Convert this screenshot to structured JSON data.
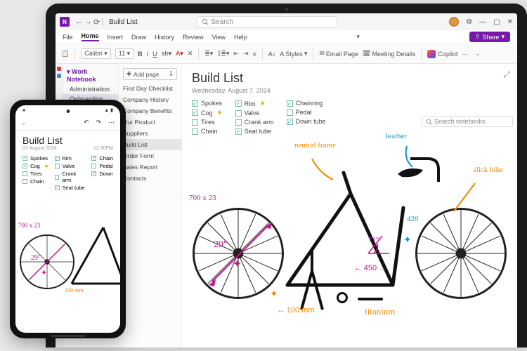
{
  "titlebar": {
    "app_glyph": "N",
    "doc_title": "Build List",
    "search_placeholder": "Search"
  },
  "window_controls": {
    "minimize": "—",
    "maximize": "▢",
    "close": "✕"
  },
  "menu": {
    "items": [
      "File",
      "Home",
      "Insert",
      "Draw",
      "History",
      "Review",
      "View",
      "Help"
    ],
    "active_index": 1,
    "share_label": "Share"
  },
  "ribbon": {
    "font_name": "Calibri",
    "font_size": "11",
    "styles_label": "Styles",
    "email_label": "Email Page",
    "meeting_label": "Meeting Details",
    "copilot_label": "Copilot",
    "more": "···",
    "search_nb_placeholder": "Search notebooks"
  },
  "notebook": {
    "title": "Work Notebook",
    "sections": [
      "Administration",
      "Onboarding"
    ],
    "selected_index": 1
  },
  "pages": {
    "add_label": "Add page",
    "items": [
      "First Day Checklist",
      "Company History",
      "Company Benefits",
      "Our Product",
      "Suppliers",
      "Build List",
      "Order Form",
      "Sales Report",
      "Contacts"
    ],
    "selected_index": 5
  },
  "page": {
    "title": "Build List",
    "date": "Wednesday, August 7, 2024",
    "checklist": [
      [
        {
          "label": "Spokes",
          "checked": true
        },
        {
          "label": "Cog",
          "checked": true,
          "star": true
        },
        {
          "label": "Tires",
          "checked": false
        },
        {
          "label": "Chain",
          "checked": false
        }
      ],
      [
        {
          "label": "Rim",
          "checked": true,
          "star": true
        },
        {
          "label": "Valve",
          "checked": false
        },
        {
          "label": "Crank arm",
          "checked": false
        },
        {
          "label": "Seat tube",
          "checked": true
        }
      ],
      [
        {
          "label": "Chainring",
          "checked": true
        },
        {
          "label": "Pedal",
          "checked": false
        },
        {
          "label": "Down tube",
          "checked": true
        }
      ]
    ],
    "annotations": {
      "size": "700 x 23",
      "wheel_diameter": "29\"",
      "fork_mm": "100 mm",
      "angle": "71°",
      "chainstay": "450",
      "seat_tube": "420",
      "frame_note": "neutral frame",
      "seat_note": "leather",
      "tire_note": "slick bike",
      "fork_material": "titanium"
    },
    "ink_colors": {
      "magenta": "#c3168c",
      "orange": "#f08a00",
      "blue": "#0099d8"
    }
  },
  "phone": {
    "status_time": "",
    "title": "Build List",
    "date": "07 August 2024",
    "time": "12:30PM",
    "checklist": [
      [
        {
          "label": "Spokes",
          "checked": true
        },
        {
          "label": "Cog",
          "checked": true,
          "star": true
        },
        {
          "label": "Tires",
          "checked": false
        },
        {
          "label": "Chain",
          "checked": false
        }
      ],
      [
        {
          "label": "Rim",
          "checked": true
        },
        {
          "label": "Valve",
          "checked": false
        },
        {
          "label": "Crank arm",
          "checked": false
        },
        {
          "label": "Seat tube",
          "checked": true
        }
      ],
      [
        {
          "label": "Chain",
          "checked": true
        },
        {
          "label": "Pedal",
          "checked": false
        },
        {
          "label": "Down",
          "checked": true
        }
      ]
    ],
    "annotations": {
      "size": "700 x 23",
      "wheel": "29\"",
      "fork": "100 mm"
    }
  }
}
